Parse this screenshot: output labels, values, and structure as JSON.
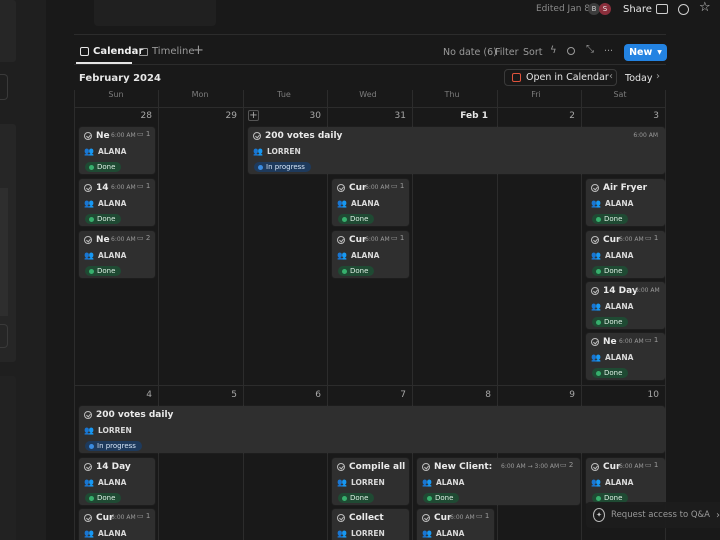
{
  "topbar": {
    "edited": "Edited Jan 8",
    "avatar_b": "B",
    "avatar_s": "S",
    "share": "Share"
  },
  "toolbar": {
    "tab_calendar": "Calendar",
    "tab_timeline": "Timeline",
    "add": "+",
    "no_date": "No date (6)",
    "filter": "Filter",
    "sort": "Sort",
    "more": "···",
    "new": "New"
  },
  "header": {
    "month": "February 2024",
    "open_in_calendar": "Open in Calendar",
    "today": "Today"
  },
  "weekdays": [
    "Sun",
    "Mon",
    "Tue",
    "Wed",
    "Thu",
    "Fri",
    "Sat"
  ],
  "week1": {
    "days": [
      "28",
      "29",
      "30",
      "31",
      "Feb 1",
      "2",
      "3"
    ]
  },
  "week2": {
    "days": [
      "4",
      "5",
      "6",
      "7",
      "8",
      "9",
      "10"
    ]
  },
  "cards": {
    "w1_span": {
      "title": "200 votes daily",
      "time": "6:00 AM",
      "person": "LORREN",
      "status": "In progress"
    },
    "w1_sun_1": {
      "title": "Ne",
      "time": "6:00 AM",
      "comments": "1",
      "person": "ALANA",
      "status": "Done"
    },
    "w1_sun_2": {
      "title": "14",
      "time": "6:00 AM",
      "comments": "1",
      "person": "ALANA",
      "status": "Done"
    },
    "w1_sun_3": {
      "title": "Ne",
      "time": "6:00 AM",
      "comments": "2",
      "person": "ALANA",
      "status": "Done"
    },
    "w1_wed_1": {
      "title": "Cur",
      "time": "6:00 AM",
      "comments": "1",
      "person": "ALANA",
      "status": "Done"
    },
    "w1_wed_2": {
      "title": "Cur",
      "time": "6:00 AM",
      "comments": "1",
      "person": "ALANA",
      "status": "Done"
    },
    "w1_sat_1": {
      "title": "Air Fryer",
      "person": "ALANA",
      "status": "Done"
    },
    "w1_sat_2": {
      "title": "Cur",
      "time": "6:00 AM",
      "comments": "1",
      "person": "ALANA",
      "status": "Done"
    },
    "w1_sat_3": {
      "title": "14 Day",
      "time": "6:00 AM",
      "person": "ALANA",
      "status": "Done"
    },
    "w1_sat_4": {
      "title": "Ne",
      "time": "6:00 AM",
      "comments": "1",
      "person": "ALANA",
      "status": "Done"
    },
    "w2_span": {
      "title": "200 votes daily",
      "person": "LORREN",
      "status": "In progress"
    },
    "w2_sun_1": {
      "title": "14 Day",
      "person": "ALANA",
      "status": "Done"
    },
    "w2_sun_2": {
      "title": "Cur",
      "time": "6:00 AM",
      "comments": "1",
      "person": "ALANA"
    },
    "w2_wed_1": {
      "title": "Compile all",
      "person": "LORREN",
      "status": "Done"
    },
    "w2_wed_2": {
      "title": "Collect",
      "person": "LORREN"
    },
    "w2_thu_1": {
      "title": "New Client:",
      "time": "6:00 AM → 3:00 AM",
      "comments": "2",
      "person": "ALANA",
      "status": "Done"
    },
    "w2_thu_2": {
      "title": "Cur",
      "time": "6:00 AM",
      "comments": "1",
      "person": "ALANA"
    },
    "w2_sat_1": {
      "title": "Cur",
      "time": "6:00 AM",
      "comments": "1",
      "person": "ALANA",
      "status": "Done"
    }
  },
  "qa": {
    "label": "Request access to Q&A"
  }
}
